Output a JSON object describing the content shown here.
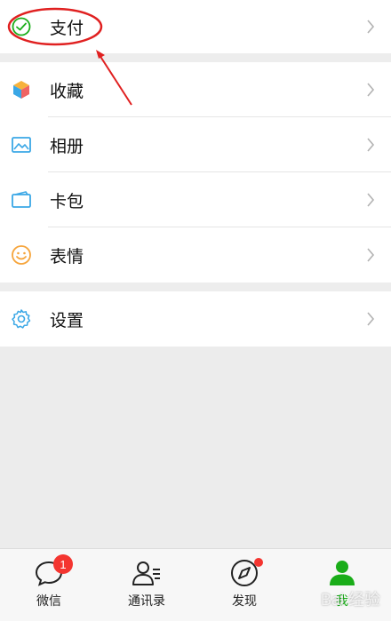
{
  "menu": {
    "pay": {
      "label": "支付",
      "icon": "wallet-check-icon"
    },
    "items": [
      {
        "label": "收藏",
        "icon": "cube-icon"
      },
      {
        "label": "相册",
        "icon": "photo-icon"
      },
      {
        "label": "卡包",
        "icon": "card-icon"
      },
      {
        "label": "表情",
        "icon": "smiley-icon"
      }
    ],
    "settings": {
      "label": "设置",
      "icon": "gear-icon"
    }
  },
  "tabbar": {
    "tabs": [
      {
        "label": "微信",
        "icon": "chat-bubble-icon",
        "badge": "1"
      },
      {
        "label": "通讯录",
        "icon": "contacts-icon"
      },
      {
        "label": "发现",
        "icon": "compass-icon",
        "has_dot": true
      },
      {
        "label": "我",
        "icon": "person-icon",
        "active": true
      }
    ]
  },
  "colors": {
    "accent": "#1aad19",
    "badge": "#f43530",
    "annotation": "#e02020"
  }
}
